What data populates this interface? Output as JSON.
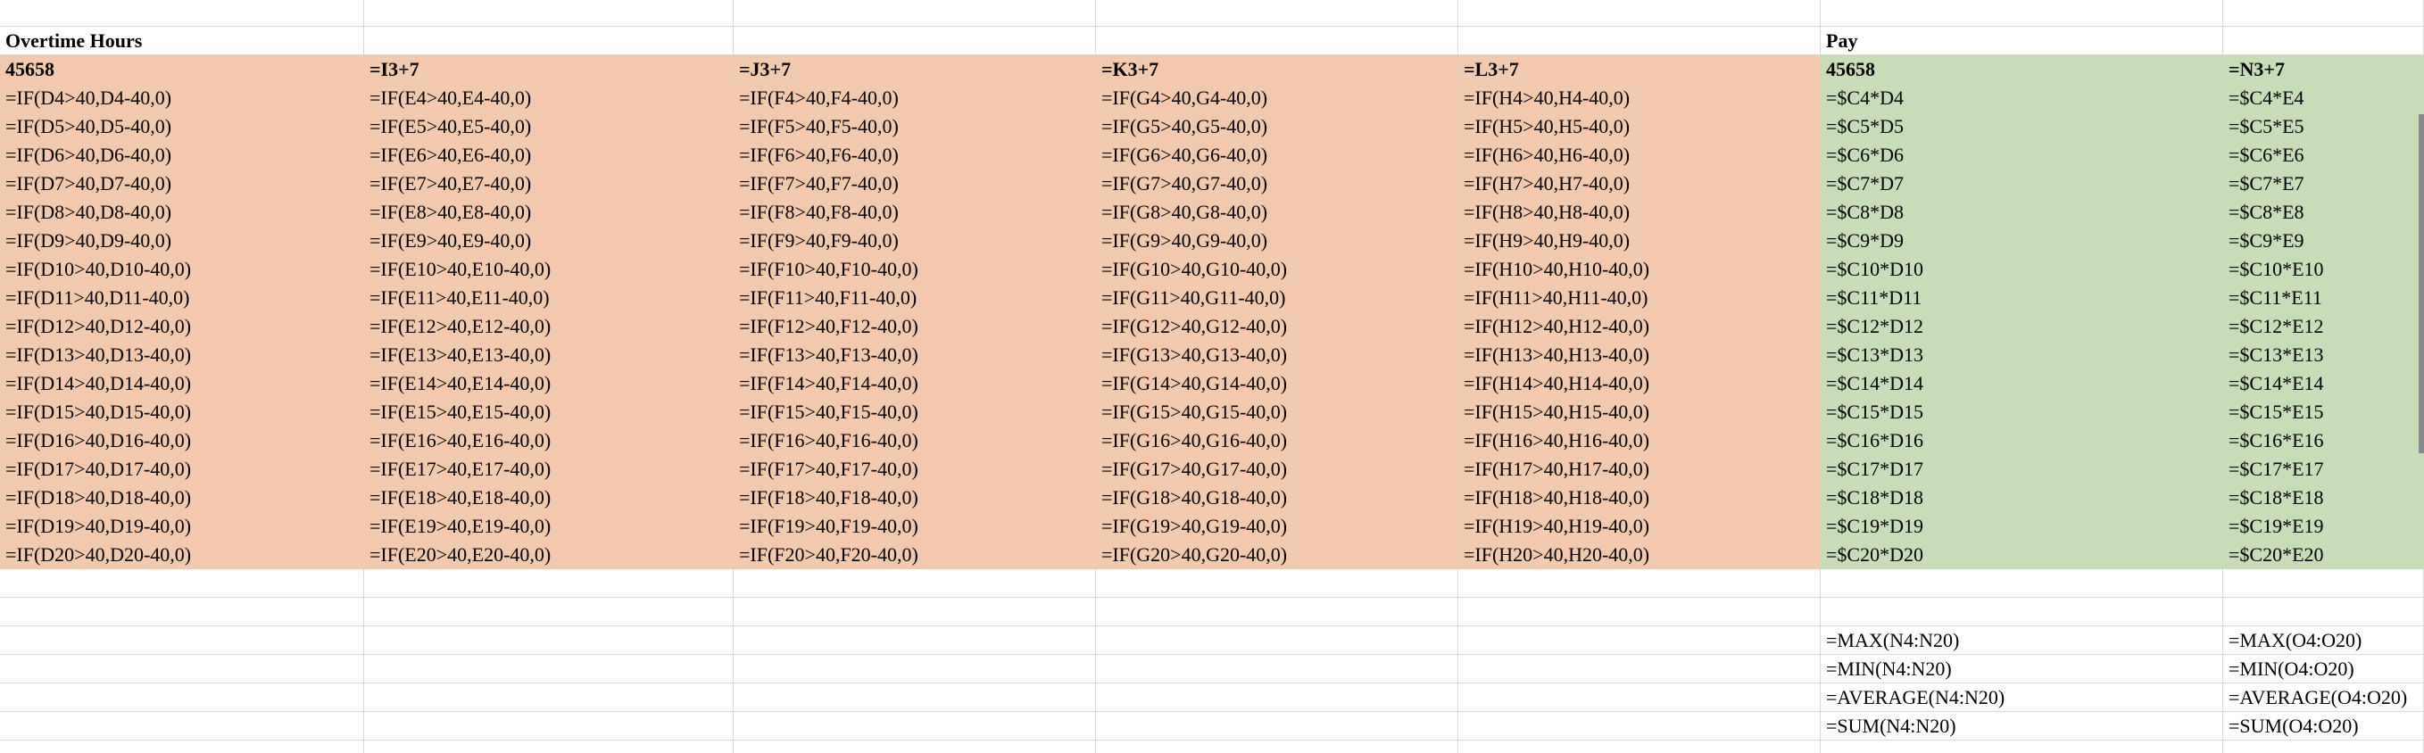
{
  "headers": [
    "Overtime Hours",
    "",
    "",
    "",
    "",
    "Pay",
    ""
  ],
  "rows": [
    [
      "45658",
      "=I3+7",
      "=J3+7",
      "=K3+7",
      "=L3+7",
      "45658",
      "=N3+7"
    ],
    [
      "=IF(D4>40,D4-40,0)",
      "=IF(E4>40,E4-40,0)",
      "=IF(F4>40,F4-40,0)",
      "=IF(G4>40,G4-40,0)",
      "=IF(H4>40,H4-40,0)",
      "=$C4*D4",
      "=$C4*E4"
    ],
    [
      "=IF(D5>40,D5-40,0)",
      "=IF(E5>40,E5-40,0)",
      "=IF(F5>40,F5-40,0)",
      "=IF(G5>40,G5-40,0)",
      "=IF(H5>40,H5-40,0)",
      "=$C5*D5",
      "=$C5*E5"
    ],
    [
      "=IF(D6>40,D6-40,0)",
      "=IF(E6>40,E6-40,0)",
      "=IF(F6>40,F6-40,0)",
      "=IF(G6>40,G6-40,0)",
      "=IF(H6>40,H6-40,0)",
      "=$C6*D6",
      "=$C6*E6"
    ],
    [
      "=IF(D7>40,D7-40,0)",
      "=IF(E7>40,E7-40,0)",
      "=IF(F7>40,F7-40,0)",
      "=IF(G7>40,G7-40,0)",
      "=IF(H7>40,H7-40,0)",
      "=$C7*D7",
      "=$C7*E7"
    ],
    [
      "=IF(D8>40,D8-40,0)",
      "=IF(E8>40,E8-40,0)",
      "=IF(F8>40,F8-40,0)",
      "=IF(G8>40,G8-40,0)",
      "=IF(H8>40,H8-40,0)",
      "=$C8*D8",
      "=$C8*E8"
    ],
    [
      "=IF(D9>40,D9-40,0)",
      "=IF(E9>40,E9-40,0)",
      "=IF(F9>40,F9-40,0)",
      "=IF(G9>40,G9-40,0)",
      "=IF(H9>40,H9-40,0)",
      "=$C9*D9",
      "=$C9*E9"
    ],
    [
      "=IF(D10>40,D10-40,0)",
      "=IF(E10>40,E10-40,0)",
      "=IF(F10>40,F10-40,0)",
      "=IF(G10>40,G10-40,0)",
      "=IF(H10>40,H10-40,0)",
      "=$C10*D10",
      "=$C10*E10"
    ],
    [
      "=IF(D11>40,D11-40,0)",
      "=IF(E11>40,E11-40,0)",
      "=IF(F11>40,F11-40,0)",
      "=IF(G11>40,G11-40,0)",
      "=IF(H11>40,H11-40,0)",
      "=$C11*D11",
      "=$C11*E11"
    ],
    [
      "=IF(D12>40,D12-40,0)",
      "=IF(E12>40,E12-40,0)",
      "=IF(F12>40,F12-40,0)",
      "=IF(G12>40,G12-40,0)",
      "=IF(H12>40,H12-40,0)",
      "=$C12*D12",
      "=$C12*E12"
    ],
    [
      "=IF(D13>40,D13-40,0)",
      "=IF(E13>40,E13-40,0)",
      "=IF(F13>40,F13-40,0)",
      "=IF(G13>40,G13-40,0)",
      "=IF(H13>40,H13-40,0)",
      "=$C13*D13",
      "=$C13*E13"
    ],
    [
      "=IF(D14>40,D14-40,0)",
      "=IF(E14>40,E14-40,0)",
      "=IF(F14>40,F14-40,0)",
      "=IF(G14>40,G14-40,0)",
      "=IF(H14>40,H14-40,0)",
      "=$C14*D14",
      "=$C14*E14"
    ],
    [
      "=IF(D15>40,D15-40,0)",
      "=IF(E15>40,E15-40,0)",
      "=IF(F15>40,F15-40,0)",
      "=IF(G15>40,G15-40,0)",
      "=IF(H15>40,H15-40,0)",
      "=$C15*D15",
      "=$C15*E15"
    ],
    [
      "=IF(D16>40,D16-40,0)",
      "=IF(E16>40,E16-40,0)",
      "=IF(F16>40,F16-40,0)",
      "=IF(G16>40,G16-40,0)",
      "=IF(H16>40,H16-40,0)",
      "=$C16*D16",
      "=$C16*E16"
    ],
    [
      "=IF(D17>40,D17-40,0)",
      "=IF(E17>40,E17-40,0)",
      "=IF(F17>40,F17-40,0)",
      "=IF(G17>40,G17-40,0)",
      "=IF(H17>40,H17-40,0)",
      "=$C17*D17",
      "=$C17*E17"
    ],
    [
      "=IF(D18>40,D18-40,0)",
      "=IF(E18>40,E18-40,0)",
      "=IF(F18>40,F18-40,0)",
      "=IF(G18>40,G18-40,0)",
      "=IF(H18>40,H18-40,0)",
      "=$C18*D18",
      "=$C18*E18"
    ],
    [
      "=IF(D19>40,D19-40,0)",
      "=IF(E19>40,E19-40,0)",
      "=IF(F19>40,F19-40,0)",
      "=IF(G19>40,G19-40,0)",
      "=IF(H19>40,H19-40,0)",
      "=$C19*D19",
      "=$C19*E19"
    ],
    [
      "=IF(D20>40,D20-40,0)",
      "=IF(E20>40,E20-40,0)",
      "=IF(F20>40,F20-40,0)",
      "=IF(G20>40,G20-40,0)",
      "=IF(H20>40,H20-40,0)",
      "=$C20*D20",
      "=$C20*E20"
    ]
  ],
  "stats": [
    [
      "=MAX(N4:N20)",
      "=MAX(O4:O20)"
    ],
    [
      "=MIN(N4:N20)",
      "=MIN(O4:O20)"
    ],
    [
      "=AVERAGE(N4:N20)",
      "=AVERAGE(O4:O20)"
    ],
    [
      "=SUM(N4:N20)",
      "=SUM(O4:O20)"
    ]
  ],
  "colors": {
    "overtime_fill": "#f2c9ad",
    "pay_fill": "#c8ddb7",
    "gridline": "#d9d9d9"
  }
}
